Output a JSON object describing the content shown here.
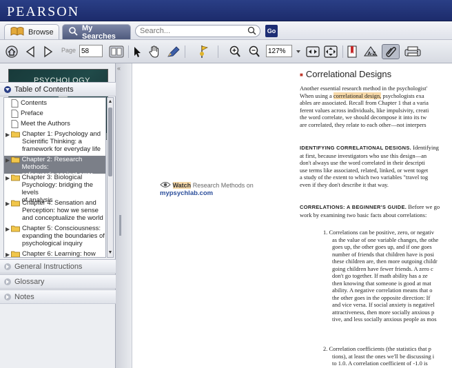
{
  "header": {
    "brand": "PEARSON"
  },
  "tabs": {
    "browse": "Browse",
    "my_searches": "My Searches"
  },
  "search": {
    "placeholder": "Search...",
    "value": "Search...",
    "go": "Go"
  },
  "toolbar": {
    "page_label": "Page",
    "page_value": "58",
    "zoom_value": "127%"
  },
  "book": {
    "cover_title": "PSYCHOLOGY"
  },
  "sidebar": {
    "toc_header": "Table of Contents",
    "toc": [
      {
        "label": "Contents",
        "type": "page"
      },
      {
        "label": "Preface",
        "type": "page"
      },
      {
        "label": "Meet the Authors",
        "type": "page"
      },
      {
        "lines": [
          "Chapter 1: Psychology and",
          "Scientific Thinking: a",
          "framework for everyday life"
        ],
        "type": "folder"
      },
      {
        "lines": [
          "Chapter 2: Research Methods:",
          "safeguards against error"
        ],
        "type": "folder",
        "selected": true
      },
      {
        "lines": [
          "Chapter 3: Biological",
          "Psychology: bridging the levels",
          "of analysis"
        ],
        "type": "folder"
      },
      {
        "lines": [
          "Chapter 4: Sensation and",
          "Perception: how we sense",
          "and conceptualize the world"
        ],
        "type": "folder"
      },
      {
        "lines": [
          "Chapter 5: Consciousness:",
          "expanding the boundaries of",
          "psychological inquiry"
        ],
        "type": "folder"
      },
      {
        "lines": [
          "Chapter 6: Learning: how"
        ],
        "type": "folder"
      }
    ],
    "general": "General Instructions",
    "glossary": "Glossary",
    "notes": "Notes"
  },
  "left_page": {
    "watch": "Watch",
    "watch_text": " Research Methods on",
    "watch_link": "mypsychlab.com"
  },
  "right_page": {
    "title": "Correlational Designs",
    "p1": [
      "Another essential research method in the psychologist'",
      "When using a ",
      "correlational design,",
      " psychologists exa",
      "ables are associated. Recall from Chapter 1 that a varia",
      "ferent values across individuals, like impulsivity, creati",
      "the word correlate, we should decompose it into its tw",
      "are correlated, they relate to each other—not interpers"
    ],
    "p2_head": "IDENTIFYING CORRELATIONAL DESIGNS.",
    "p2": [
      " Identifying",
      "at first, because investigators who use this design—an",
      "don't always use the word correlated in their descripti",
      "use terms like associated, related, linked, or went toget",
      "a study of the extent to which two variables \"travel tog",
      "even if they don't describe it that way."
    ],
    "p3_head": "CORRELATIONS: A BEGINNER'S GUIDE.",
    "p3": [
      " Before we go",
      "work by examining two basic facts about correlations:"
    ],
    "list1": [
      "1.  Correlations can be positive, zero, or negativ",
      "as the value of one variable changes, the othe",
      "goes up, the other goes up, and if one goes",
      "number of friends that children have is posi",
      "these children are, then more outgoing childr",
      "going children have fewer friends. A zero c",
      "don't go together. If math ability has a ze",
      "then knowing that someone is good at mat",
      "ability. A negative correlation means that o",
      "the other goes in the opposite direction: If",
      "and vice versa. If social anxiety is negativel",
      "attractiveness, then more socially anxious p",
      "tive, and less socially anxious people as mos"
    ],
    "list2": [
      "2.  Correlation coefficients (the statistics that p",
      "tions), at least the ones we'll be discussing i",
      "to 1.0. A correlation coefficient of -1.0 is"
    ]
  }
}
